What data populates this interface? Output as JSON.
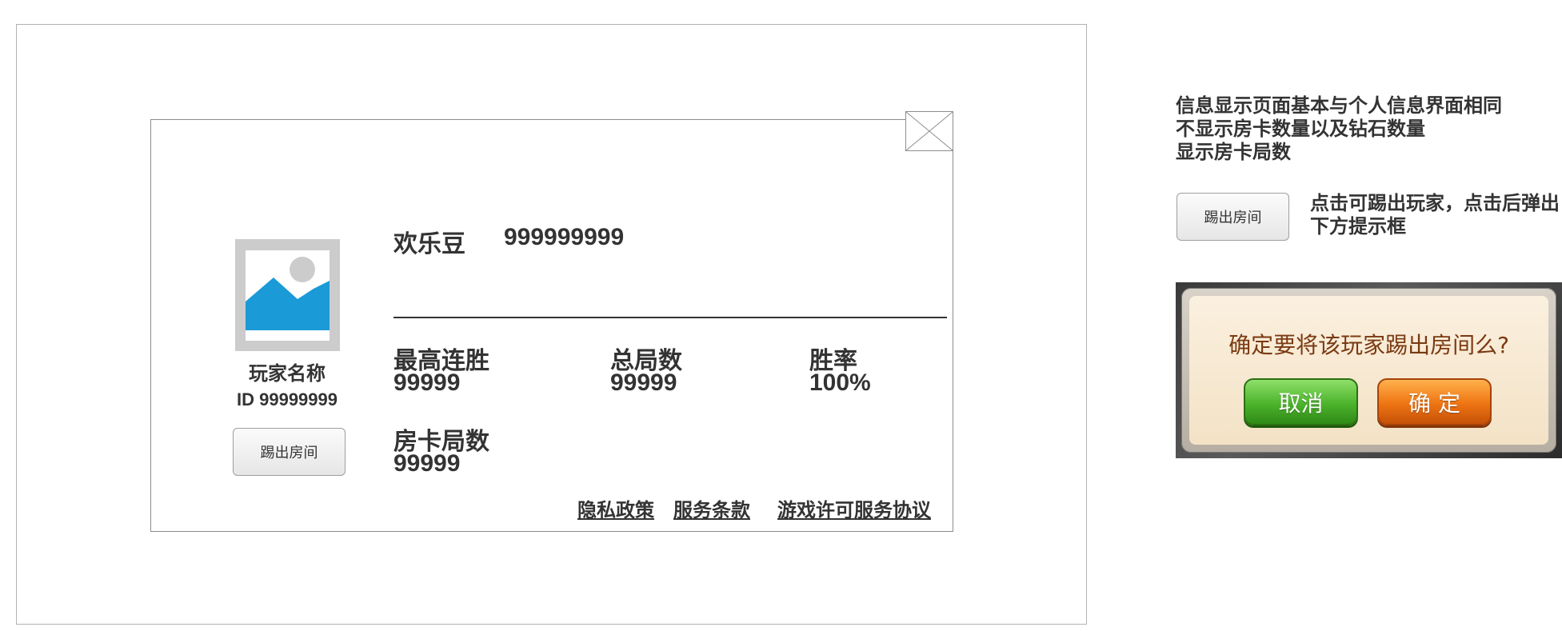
{
  "profile": {
    "player_name": "玩家名称",
    "player_id": "ID 99999999",
    "kick_button_label": "踢出房间",
    "beans_label": "欢乐豆",
    "beans_value": "999999999",
    "stats": {
      "max_streak_label": "最高连胜",
      "max_streak_value": "99999",
      "total_games_label": "总局数",
      "total_games_value": "99999",
      "win_rate_label": "胜率",
      "win_rate_value": "100%",
      "room_card_label": "房卡局数",
      "room_card_value": "99999"
    },
    "links": {
      "privacy": "隐私政策",
      "service": "服务条款",
      "license": "游戏许可服务协议"
    }
  },
  "notes": {
    "line1": "信息显示页面基本与个人信息界面相同",
    "line2": "不显示房卡数量以及钻石数量",
    "line3": "显示房卡局数",
    "kick_button_label": "踢出房间",
    "kick_note_line1": "点击可踢出玩家，点击后弹出",
    "kick_note_line2": "下方提示框"
  },
  "dialog": {
    "message": "确定要将该玩家踢出房间么?",
    "cancel_label": "取消",
    "confirm_label": "确 定"
  },
  "colors": {
    "avatar_placeholder": "#cccccc",
    "avatar_mountain": "#1a9ad6",
    "cancel_green": "#4cb32c",
    "confirm_orange": "#ee7412",
    "dialog_text": "#7a3a12"
  },
  "icons": {
    "close": "close-x-icon",
    "avatar": "image-placeholder-icon"
  }
}
